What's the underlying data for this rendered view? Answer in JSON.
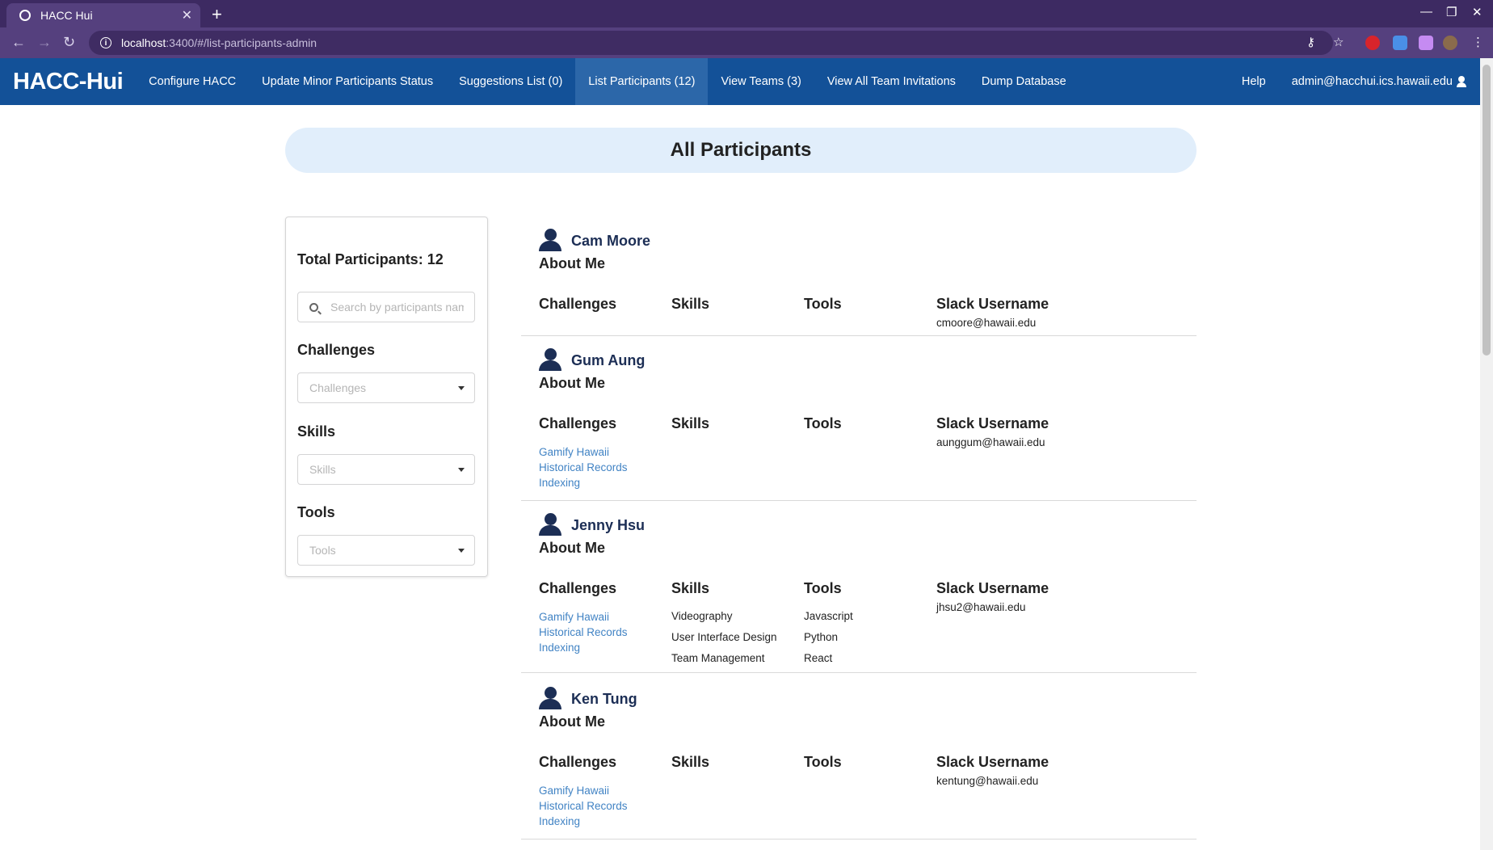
{
  "browser": {
    "tab_title": "HACC Hui",
    "url_host": "localhost",
    "url_path": ":3400/#/list-participants-admin"
  },
  "navbar": {
    "brand": "HACC-Hui",
    "items": [
      {
        "label": "Configure HACC"
      },
      {
        "label": "Update Minor Participants Status"
      },
      {
        "label": "Suggestions List (0)"
      },
      {
        "label": "List Participants (12)",
        "active": true
      },
      {
        "label": "View Teams (3)"
      },
      {
        "label": "View All Team Invitations"
      },
      {
        "label": "Dump Database"
      }
    ],
    "help": "Help",
    "user": "admin@hacchui.ics.hawaii.edu",
    "bg_color": "#135198"
  },
  "page": {
    "title": "All Participants"
  },
  "filters": {
    "total_label": "Total Participants: 12",
    "search_placeholder": "Search by participants name...",
    "challenges_label": "Challenges",
    "challenges_placeholder": "Challenges",
    "skills_label": "Skills",
    "skills_placeholder": "Skills",
    "tools_label": "Tools",
    "tools_placeholder": "Tools"
  },
  "columns": {
    "about": "About Me",
    "challenges": "Challenges",
    "skills": "Skills",
    "tools": "Tools",
    "slack": "Slack Username"
  },
  "participants": [
    {
      "name": "Cam Moore",
      "slack": "cmoore@hawaii.edu",
      "challenges": [],
      "skills": [],
      "tools": []
    },
    {
      "name": "Gum Aung",
      "slack": "aunggum@hawaii.edu",
      "challenges": [
        "Gamify Hawaii",
        "Historical Records",
        "Indexing"
      ],
      "skills": [],
      "tools": []
    },
    {
      "name": "Jenny Hsu",
      "slack": "jhsu2@hawaii.edu",
      "challenges": [
        "Gamify Hawaii",
        "Historical Records",
        "Indexing"
      ],
      "skills": [
        "Videography",
        "User Interface Design",
        "Team Management"
      ],
      "tools": [
        "Javascript",
        "Python",
        "React"
      ]
    },
    {
      "name": "Ken Tung",
      "slack": "kentung@hawaii.edu",
      "challenges": [
        "Gamify Hawaii",
        "Historical Records",
        "Indexing"
      ],
      "skills": [],
      "tools": []
    }
  ]
}
